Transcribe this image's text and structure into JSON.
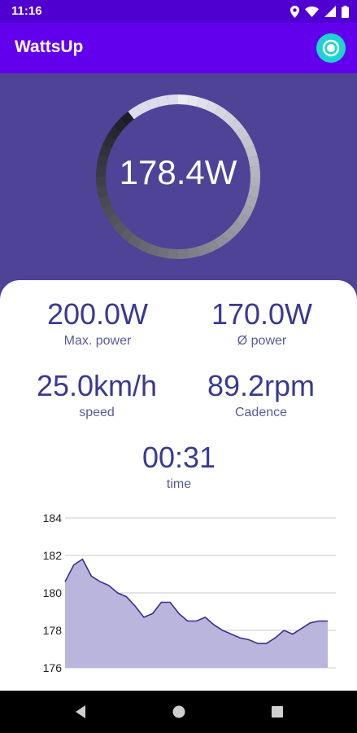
{
  "status_bar": {
    "time": "11:16"
  },
  "app": {
    "title": "WattsUp"
  },
  "power": {
    "current": "178.4W",
    "level": 0.892
  },
  "stats": {
    "max_power": {
      "value": "200.0W",
      "label": "Max. power"
    },
    "avg_power": {
      "value": "170.0W",
      "label": "Ø power"
    },
    "speed": {
      "value": "25.0km/h",
      "label": "speed"
    },
    "cadence": {
      "value": "89.2rpm",
      "label": "Cadence"
    },
    "time": {
      "value": "00:31",
      "label": "time"
    }
  },
  "chart_data": {
    "type": "area",
    "x": [
      0,
      1,
      2,
      3,
      4,
      5,
      6,
      7,
      8,
      9,
      10,
      11,
      12,
      13,
      14,
      15,
      16,
      17,
      18,
      19,
      20,
      21,
      22,
      23,
      24,
      25,
      26,
      27,
      28,
      29,
      30
    ],
    "values": [
      180.6,
      181.5,
      181.8,
      180.9,
      180.6,
      180.4,
      180.0,
      179.8,
      179.3,
      178.7,
      178.9,
      179.5,
      179.5,
      178.9,
      178.5,
      178.5,
      178.7,
      178.3,
      178.0,
      177.8,
      177.6,
      177.5,
      177.3,
      177.3,
      177.6,
      178.0,
      177.8,
      178.1,
      178.4,
      178.5,
      178.5
    ],
    "ylim": [
      176,
      184
    ],
    "yticks": [
      "176",
      "178",
      "180",
      "182",
      "184"
    ],
    "color": "#3a2f8f",
    "fill": "#b9b5dd",
    "grid": true
  }
}
